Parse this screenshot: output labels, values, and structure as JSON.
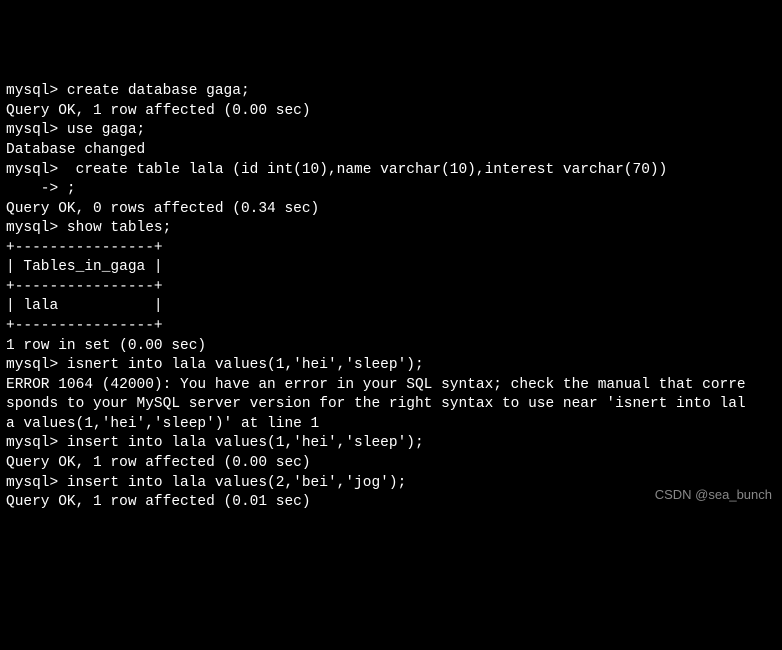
{
  "terminal": {
    "lines": [
      "mysql> create database gaga;",
      "Query OK, 1 row affected (0.00 sec)",
      "",
      "mysql> use gaga;",
      "Database changed",
      "mysql>  create table lala (id int(10),name varchar(10),interest varchar(70))",
      "    -> ;",
      "Query OK, 0 rows affected (0.34 sec)",
      "",
      "mysql> show tables;",
      "+----------------+",
      "| Tables_in_gaga |",
      "+----------------+",
      "| lala           |",
      "+----------------+",
      "1 row in set (0.00 sec)",
      "",
      "mysql> isnert into lala values(1,'hei','sleep');",
      "ERROR 1064 (42000): You have an error in your SQL syntax; check the manual that corre",
      "sponds to your MySQL server version for the right syntax to use near 'isnert into lal",
      "a values(1,'hei','sleep')' at line 1",
      "mysql> insert into lala values(1,'hei','sleep');",
      "Query OK, 1 row affected (0.00 sec)",
      "",
      "mysql> insert into lala values(2,'bei','jog');",
      "Query OK, 1 row affected (0.01 sec)"
    ]
  },
  "watermark": "CSDN @sea_bunch"
}
